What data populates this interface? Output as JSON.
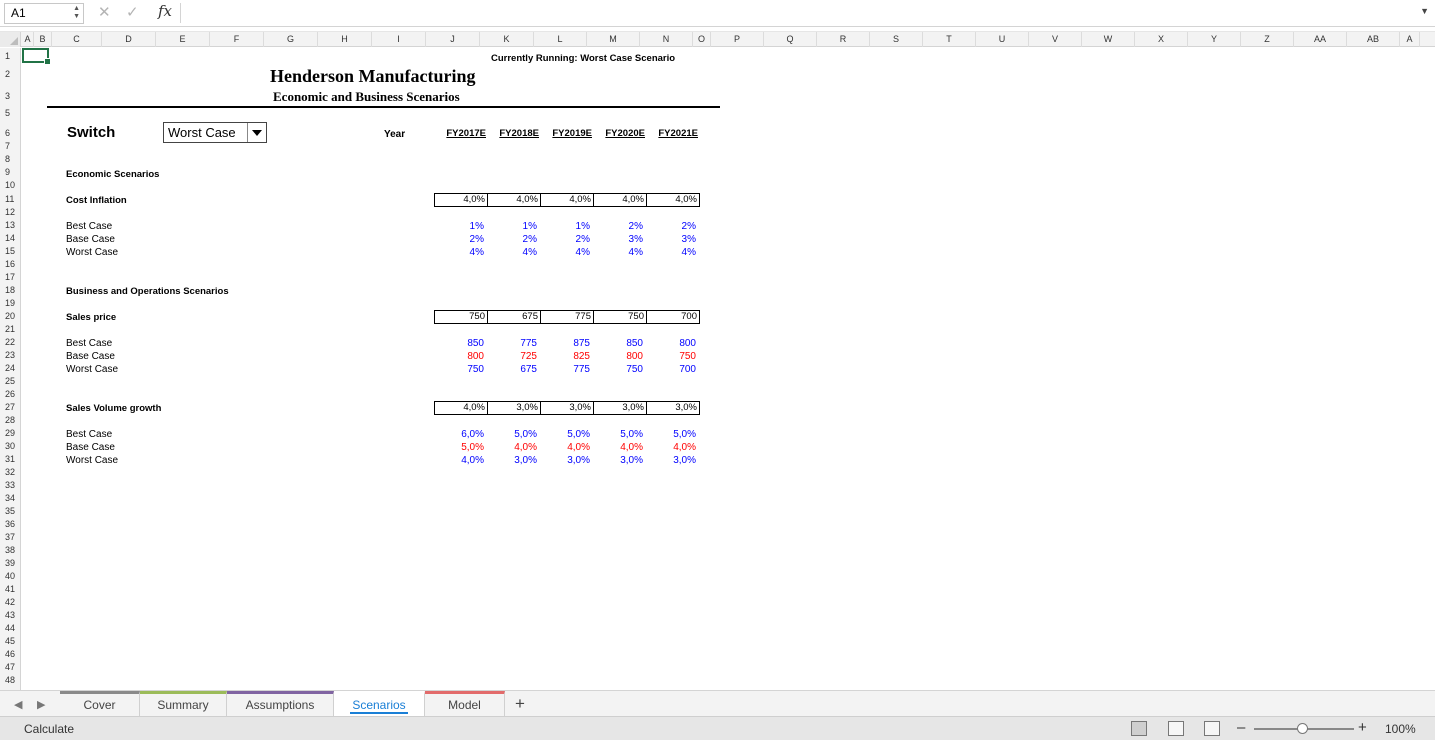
{
  "formula_bar": {
    "cell_ref": "A1",
    "formula": ""
  },
  "columns": [
    "A",
    "B",
    "C",
    "D",
    "E",
    "F",
    "G",
    "H",
    "I",
    "J",
    "K",
    "L",
    "M",
    "N",
    "O",
    "P",
    "Q",
    "R",
    "S",
    "T",
    "U",
    "V",
    "W",
    "X",
    "Y",
    "Z",
    "AA",
    "AB",
    "A"
  ],
  "rows": [
    "1",
    "2",
    "3",
    "5",
    "6",
    "7",
    "8",
    "9",
    "10",
    "11",
    "12",
    "13",
    "14",
    "15",
    "16",
    "17",
    "18",
    "19",
    "20",
    "21",
    "22",
    "23",
    "24",
    "25",
    "26",
    "27",
    "28",
    "29",
    "30",
    "31",
    "32",
    "33",
    "34",
    "35",
    "36",
    "37",
    "38",
    "39",
    "40",
    "41",
    "42",
    "43",
    "44",
    "45",
    "46",
    "47",
    "48"
  ],
  "sheet": {
    "status_line": "Currently Running: Worst Case Scenario",
    "title": "Henderson Manufacturing",
    "subtitle": "Economic and Business Scenarios",
    "switch_label": "Switch",
    "switch_value": "Worst Case",
    "year_label": "Year",
    "years": [
      "FY2017E",
      "FY2018E",
      "FY2019E",
      "FY2020E",
      "FY2021E"
    ],
    "econ_section": "Economic Scenarios",
    "cost_inflation": {
      "label": "Cost Inflation",
      "selected": [
        "4,0%",
        "4,0%",
        "4,0%",
        "4,0%",
        "4,0%"
      ],
      "scenarios": [
        {
          "label": "Best Case",
          "values": [
            "1%",
            "1%",
            "1%",
            "2%",
            "2%"
          ]
        },
        {
          "label": "Base Case",
          "values": [
            "2%",
            "2%",
            "2%",
            "3%",
            "3%"
          ]
        },
        {
          "label": "Worst Case",
          "values": [
            "4%",
            "4%",
            "4%",
            "4%",
            "4%"
          ]
        }
      ]
    },
    "biz_section": "Business and Operations Scenarios",
    "sales_price": {
      "label": "Sales price",
      "selected": [
        "750",
        "675",
        "775",
        "750",
        "700"
      ],
      "scenarios": [
        {
          "label": "Best Case",
          "values": [
            "850",
            "775",
            "875",
            "850",
            "800"
          ]
        },
        {
          "label": "Base Case",
          "values": [
            "800",
            "725",
            "825",
            "800",
            "750"
          ]
        },
        {
          "label": "Worst Case",
          "values": [
            "750",
            "675",
            "775",
            "750",
            "700"
          ]
        }
      ]
    },
    "sales_volume": {
      "label": "Sales Volume growth",
      "selected": [
        "4,0%",
        "3,0%",
        "3,0%",
        "3,0%",
        "3,0%"
      ],
      "scenarios": [
        {
          "label": "Best Case",
          "values": [
            "6,0%",
            "5,0%",
            "5,0%",
            "5,0%",
            "5,0%"
          ]
        },
        {
          "label": "Base Case",
          "values": [
            "5,0%",
            "4,0%",
            "4,0%",
            "4,0%",
            "4,0%"
          ]
        },
        {
          "label": "Worst Case",
          "values": [
            "4,0%",
            "3,0%",
            "3,0%",
            "3,0%",
            "3,0%"
          ]
        }
      ]
    }
  },
  "tabs": [
    "Cover",
    "Summary",
    "Assumptions",
    "Scenarios",
    "Model"
  ],
  "active_tab": "Scenarios",
  "tab_colors": [
    "#8a8a8a",
    "#9bbb59",
    "#8064a2",
    "#4bacc6",
    "#e26b6b"
  ],
  "status": {
    "mode": "Calculate",
    "zoom": "100%"
  }
}
